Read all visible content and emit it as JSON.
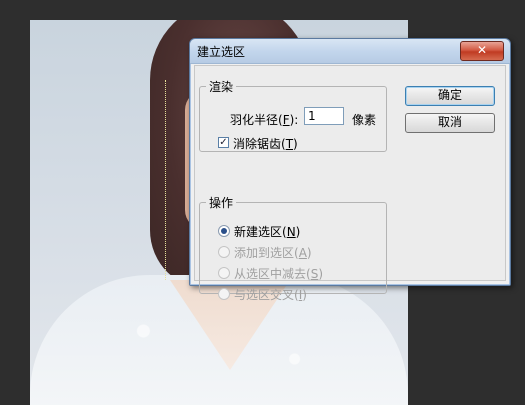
{
  "dialog": {
    "title": "建立选区",
    "close_label": "✕",
    "render_group": {
      "label": "渲染",
      "feather_label_pre": "羽化半径(",
      "feather_key": "F",
      "feather_label_post": "):",
      "feather_value": "1",
      "feather_unit": "像素",
      "antialias_pre": "消除锯齿(",
      "antialias_key": "T",
      "antialias_post": ")",
      "antialias_checked": true
    },
    "operation_group": {
      "label": "操作",
      "options": [
        {
          "pre": "新建选区(",
          "key": "N",
          "post": ")",
          "selected": true,
          "enabled": true
        },
        {
          "pre": "添加到选区(",
          "key": "A",
          "post": ")",
          "selected": false,
          "enabled": false
        },
        {
          "pre": "从选区中减去(",
          "key": "S",
          "post": ")",
          "selected": false,
          "enabled": false
        },
        {
          "pre": "与选区交叉(",
          "key": "I",
          "post": ")",
          "selected": false,
          "enabled": false
        }
      ]
    },
    "ok_label": "确定",
    "cancel_label": "取消"
  },
  "colors": {
    "background": "#2e2e2e",
    "dialog_border": "#5b7aa0",
    "close_button": "#c03b22"
  }
}
